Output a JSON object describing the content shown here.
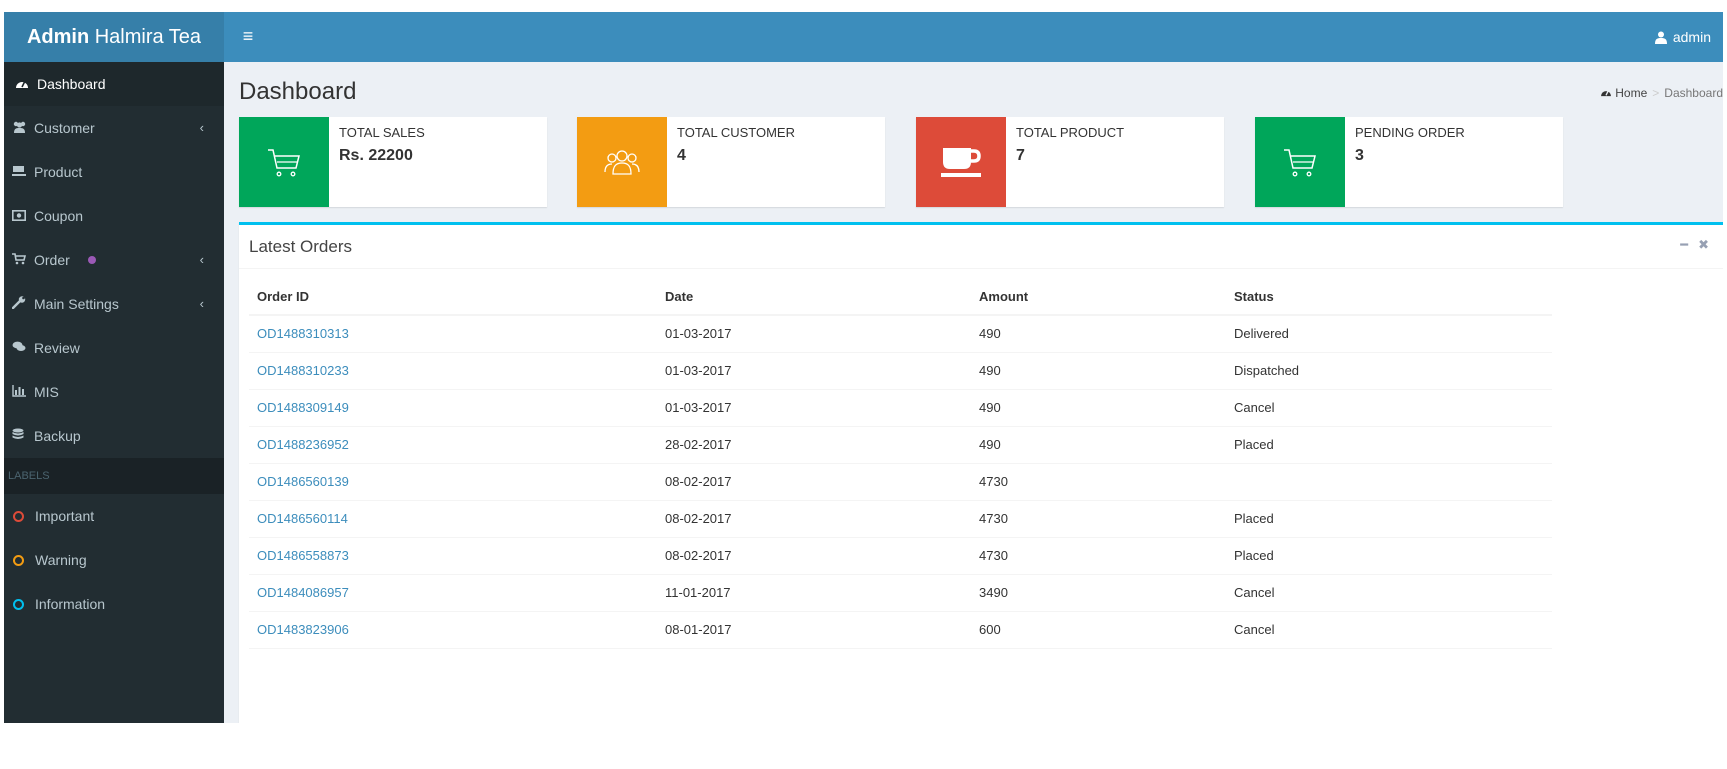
{
  "header": {
    "logo_bold": "Admin",
    "logo_rest": "Halmira Tea",
    "toggle_icon": "hamburger-icon",
    "user": "admin"
  },
  "sidebar": {
    "items": [
      {
        "label": "Dashboard",
        "icon": "dashboard-icon"
      },
      {
        "label": "Customer",
        "icon": "users-icon"
      },
      {
        "label": "Product",
        "icon": "product-icon"
      },
      {
        "label": "Coupon",
        "icon": "coupon-icon"
      },
      {
        "label": "Order",
        "icon": "cart-icon"
      },
      {
        "label": "Main Settings",
        "icon": "wrench-icon"
      },
      {
        "label": "Review",
        "icon": "comments-icon"
      },
      {
        "label": "MIS",
        "icon": "bar-chart-icon"
      },
      {
        "label": "Backup",
        "icon": "database-icon"
      }
    ],
    "labels_header": "LABELS",
    "labels": [
      {
        "label": "Important",
        "color": "#dd4b39"
      },
      {
        "label": "Warning",
        "color": "#f39c12"
      },
      {
        "label": "Information",
        "color": "#00c0ef"
      }
    ]
  },
  "page": {
    "title": "Dashboard",
    "breadcrumb_home": "Home",
    "breadcrumb_current": "Dashboard"
  },
  "stats": [
    {
      "label": "TOTAL SALES",
      "value": "Rs. 22200",
      "color": "#00a65a",
      "icon": "cart-icon"
    },
    {
      "label": "TOTAL CUSTOMER",
      "value": "4",
      "color": "#f39c12",
      "icon": "users-icon"
    },
    {
      "label": "TOTAL PRODUCT",
      "value": "7",
      "color": "#dd4b39",
      "icon": "coffee-cup-icon"
    },
    {
      "label": "PENDING ORDER",
      "value": "3",
      "color": "#00a65a",
      "icon": "cart-icon"
    }
  ],
  "orders": {
    "title": "Latest Orders",
    "columns": [
      "Order ID",
      "Date",
      "Amount",
      "Status"
    ],
    "rows": [
      [
        "OD1488310313",
        "01-03-2017",
        "490",
        "Delivered"
      ],
      [
        "OD1488310233",
        "01-03-2017",
        "490",
        "Dispatched"
      ],
      [
        "OD1488309149",
        "01-03-2017",
        "490",
        "Cancel"
      ],
      [
        "OD1488236952",
        "28-02-2017",
        "490",
        "Placed"
      ],
      [
        "OD1486560139",
        "08-02-2017",
        "4730",
        ""
      ],
      [
        "OD1486560114",
        "08-02-2017",
        "4730",
        "Placed"
      ],
      [
        "OD1486558873",
        "08-02-2017",
        "4730",
        "Placed"
      ],
      [
        "OD1484086957",
        "11-01-2017",
        "3490",
        "Cancel"
      ],
      [
        "OD1483823906",
        "08-01-2017",
        "600",
        "Cancel"
      ]
    ]
  },
  "colors": {
    "header": "#3c8dbc",
    "logo": "#367fa9",
    "sidebar": "#222d32",
    "accent": "#00c0ef"
  }
}
